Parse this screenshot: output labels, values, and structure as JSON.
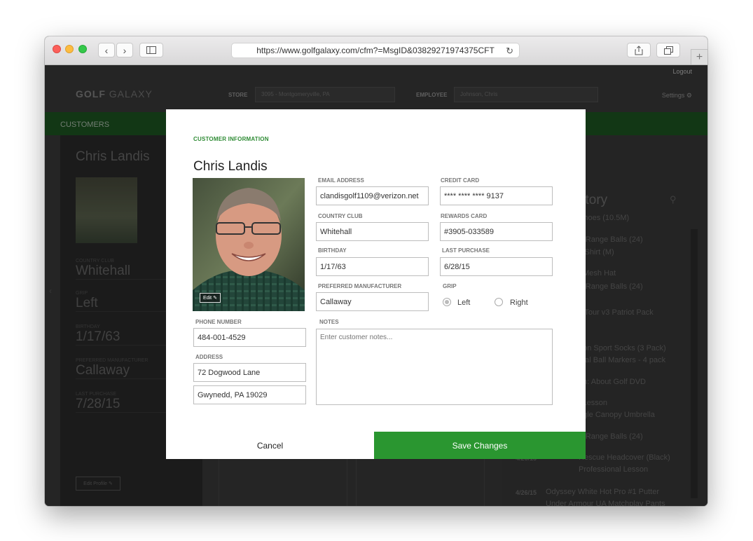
{
  "browser": {
    "url": "https://www.golfgalaxy.com/cfm?=MsgID&03829271974375CFT"
  },
  "header": {
    "logout": "Logout",
    "brand_bold": "GOLF",
    "brand_rest": " GALAXY",
    "store_label": "STORE",
    "store_value": "3095 - Montgomeryville, PA",
    "employee_label": "EMPLOYEE",
    "employee_value": "Johnson, Chris",
    "settings": "Settings"
  },
  "nav": {
    "customers": "CUSTOMERS"
  },
  "profile": {
    "name": "Chris Landis",
    "fields": [
      {
        "label": "COUNTRY CLUB",
        "value": "Whitehall"
      },
      {
        "label": "GRIP",
        "value": "Left"
      },
      {
        "label": "BIRTHDAY",
        "value": "1/17/63"
      },
      {
        "label": "PREFERRED MANUFACTURER",
        "value": "Callaway"
      },
      {
        "label": "LAST PURCHASE",
        "value": "7/28/15"
      }
    ],
    "edit_profile": "Edit Profile"
  },
  "history": {
    "title_partial": "story",
    "items": [
      {
        "date": "",
        "text": "Shoes (10.5M)"
      },
      {
        "date": "",
        "text": "d-Range Balls (24)"
      },
      {
        "date": "",
        "text": "s Shirt (M)"
      },
      {
        "date": "",
        "text": "t Mesh Hat"
      },
      {
        "date": "",
        "text": "d-Range Balls (24)"
      },
      {
        "date": "",
        "text": "lf Tour v3 Patriot Pack"
      },
      {
        "date": "",
        "text": "tton Sport Socks (3 Pack)"
      },
      {
        "date": "",
        "text": "etal Ball Markers - 4 pack"
      },
      {
        "date": "",
        "text": "on: About Golf DVD"
      },
      {
        "date": "",
        "text": "l Lesson"
      },
      {
        "date": "",
        "text": "ngle Canopy Umbrella"
      },
      {
        "date": "",
        "text": "d-Range Balls (24)"
      },
      {
        "date": "4/26/15",
        "text": "Rescue Headcover (Black)"
      },
      {
        "date": "",
        "text": "Professional Lesson"
      },
      {
        "date": "4/26/15",
        "text": "Odyssey White Hot Pro #1 Putter"
      },
      {
        "date": "",
        "text": "Under Armour UA Matchplay Pants"
      }
    ]
  },
  "modal": {
    "section_title": "CUSTOMER INFORMATION",
    "name": "Chris Landis",
    "photo_edit": "Edit",
    "email_label": "EMAIL ADDRESS",
    "email": "clandisgolf1109@verizon.net",
    "credit_label": "CREDIT CARD",
    "credit": "**** **** **** 9137",
    "club_label": "COUNTRY CLUB",
    "club": "Whitehall",
    "rewards_label": "REWARDS CARD",
    "rewards": "#3905-033589",
    "birthday_label": "BIRTHDAY",
    "birthday": "1/17/63",
    "last_purchase_label": "LAST PURCHASE",
    "last_purchase": "6/28/15",
    "manufacturer_label": "PREFERRED MANUFACTURER",
    "manufacturer": "Callaway",
    "grip_label": "GRIP",
    "grip_left": "Left",
    "grip_right": "Right",
    "grip_selected": "Left",
    "phone_label": "PHONE NUMBER",
    "phone": "484-001-4529",
    "address_label": "ADDRESS",
    "address1": "72 Dogwood Lane",
    "address2": "Gwynedd, PA 19029",
    "notes_label": "NOTES",
    "notes_placeholder": "Enter customer notes...",
    "cancel": "Cancel",
    "save": "Save Changes"
  },
  "colors": {
    "accent_green": "#2a9630",
    "section_green": "#2e8b34",
    "nav_green": "#1e5a23"
  }
}
